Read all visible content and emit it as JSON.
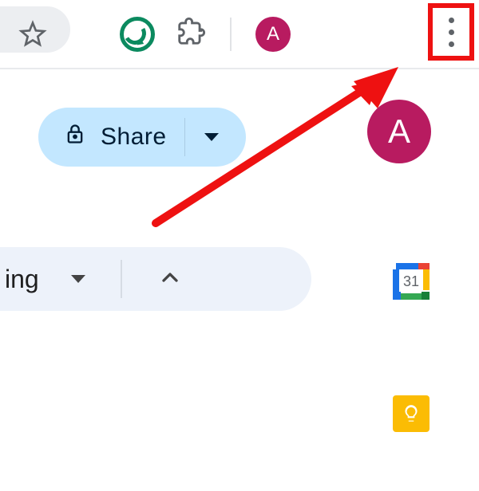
{
  "browser": {
    "profile_letter": "A",
    "accent_color": "#b81b60",
    "annotation_color": "#ee1111"
  },
  "docs": {
    "share_label": "Share",
    "profile_letter": "A"
  },
  "toolbar": {
    "mode_suffix": "ing"
  },
  "side": {
    "calendar_day": "31"
  }
}
